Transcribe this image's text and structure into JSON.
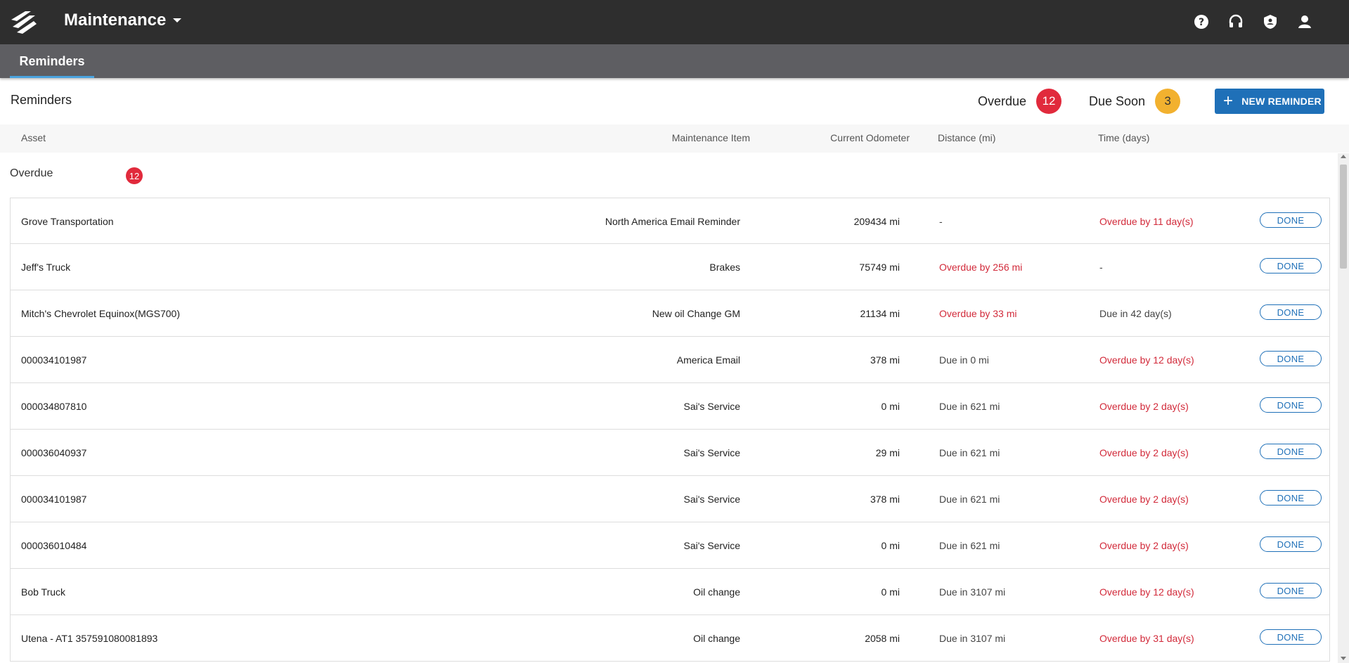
{
  "app": {
    "title": "Maintenance",
    "brand_color": "#2e2e2e",
    "accent_color": "#1f70b8",
    "icons": [
      "help-icon",
      "headset-support-icon",
      "shield-user-icon",
      "account-icon"
    ]
  },
  "subnav": {
    "active_tab": "Reminders"
  },
  "header": {
    "title": "Reminders",
    "overdue_label": "Overdue",
    "overdue_count": "12",
    "due_soon_label": "Due Soon",
    "due_soon_count": "3",
    "new_button": "NEW REMINDER"
  },
  "columns": {
    "asset": "Asset",
    "item": "Maintenance Item",
    "odometer": "Current Odometer",
    "distance": "Distance (mi)",
    "time": "Time (days)"
  },
  "section": {
    "label": "Overdue",
    "count": "12"
  },
  "rows": [
    {
      "asset": "Grove Transportation",
      "item": "North America Email Reminder",
      "odometer": "209434 mi",
      "distance": "-",
      "distance_status": "normal",
      "time": "Overdue by 11 day(s)",
      "time_status": "overdue",
      "action": "DONE"
    },
    {
      "asset": "Jeff's Truck",
      "item": "Brakes",
      "odometer": "75749 mi",
      "distance": "Overdue by 256 mi",
      "distance_status": "overdue",
      "time": "-",
      "time_status": "normal",
      "action": "DONE"
    },
    {
      "asset": "Mitch's Chevrolet Equinox(MGS700)",
      "item": "New oil Change GM",
      "odometer": "21134 mi",
      "distance": "Overdue by 33 mi",
      "distance_status": "overdue",
      "time": "Due in 42 day(s)",
      "time_status": "normal",
      "action": "DONE"
    },
    {
      "asset": "000034101987",
      "item": "America Email",
      "odometer": "378 mi",
      "distance": "Due in 0 mi",
      "distance_status": "normal",
      "time": "Overdue by 12 day(s)",
      "time_status": "overdue",
      "action": "DONE"
    },
    {
      "asset": "000034807810",
      "item": "Sai's Service",
      "odometer": "0 mi",
      "distance": "Due in 621 mi",
      "distance_status": "normal",
      "time": "Overdue by 2 day(s)",
      "time_status": "overdue",
      "action": "DONE"
    },
    {
      "asset": "000036040937",
      "item": "Sai's Service",
      "odometer": "29 mi",
      "distance": "Due in 621 mi",
      "distance_status": "normal",
      "time": "Overdue by 2 day(s)",
      "time_status": "overdue",
      "action": "DONE"
    },
    {
      "asset": "000034101987",
      "item": "Sai's Service",
      "odometer": "378 mi",
      "distance": "Due in 621 mi",
      "distance_status": "normal",
      "time": "Overdue by 2 day(s)",
      "time_status": "overdue",
      "action": "DONE"
    },
    {
      "asset": "000036010484",
      "item": "Sai's Service",
      "odometer": "0 mi",
      "distance": "Due in 621 mi",
      "distance_status": "normal",
      "time": "Overdue by 2 day(s)",
      "time_status": "overdue",
      "action": "DONE"
    },
    {
      "asset": "Bob Truck",
      "item": "Oil change",
      "odometer": "0 mi",
      "distance": "Due in 3107 mi",
      "distance_status": "normal",
      "time": "Overdue by 12 day(s)",
      "time_status": "overdue",
      "action": "DONE"
    },
    {
      "asset": "Utena - AT1 357591080081893",
      "item": "Oil change",
      "odometer": "2058 mi",
      "distance": "Due in 3107 mi",
      "distance_status": "normal",
      "time": "Overdue by 31 day(s)",
      "time_status": "overdue",
      "action": "DONE"
    }
  ]
}
